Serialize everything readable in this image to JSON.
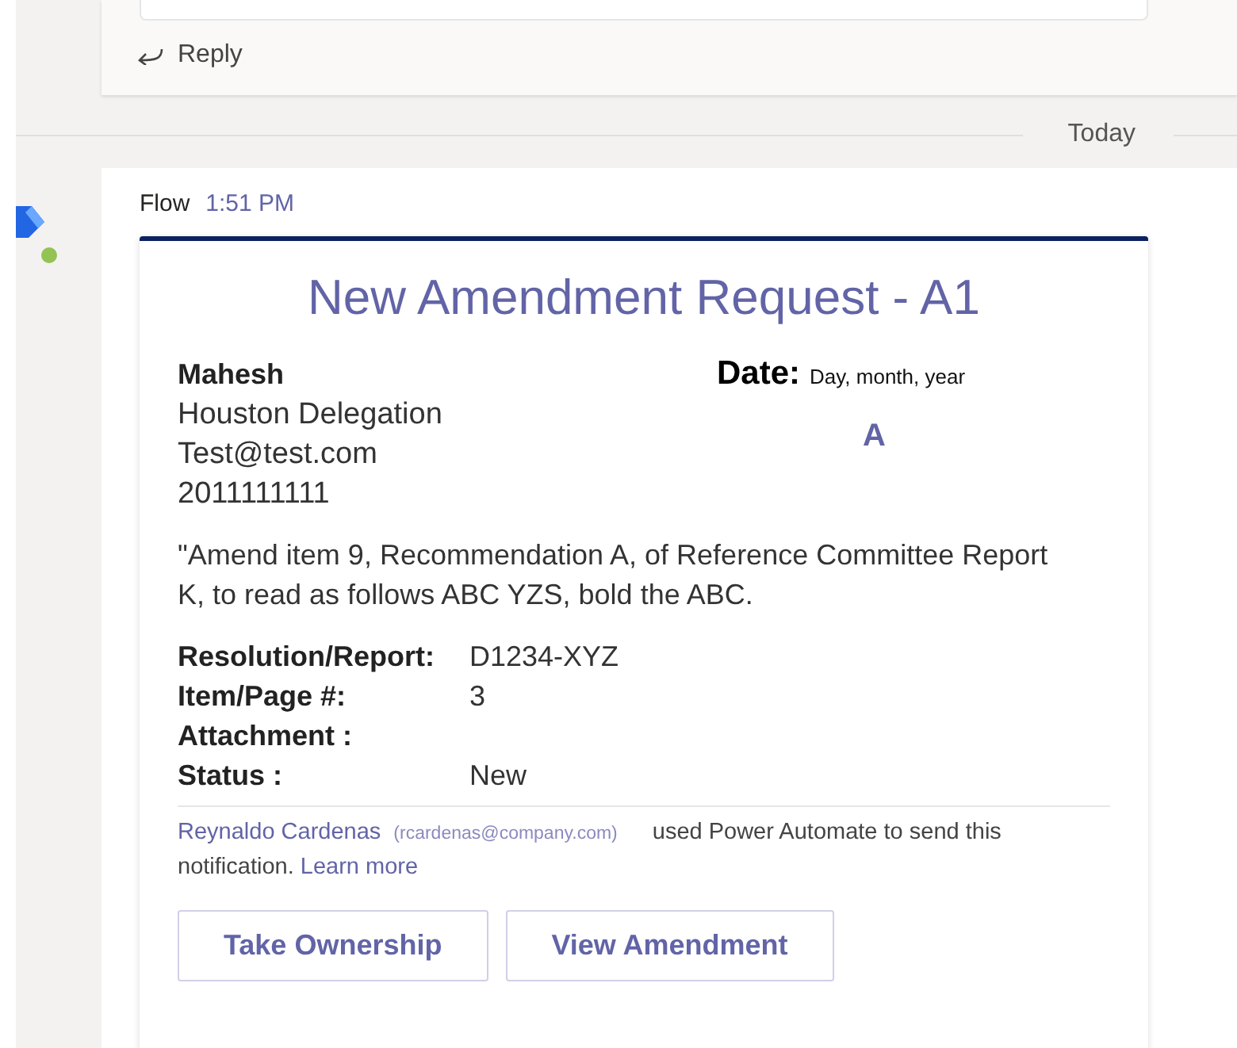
{
  "previous_message": {
    "reply_label": "Reply"
  },
  "date_divider": "Today",
  "message": {
    "sender": "Flow",
    "time": "1:51 PM",
    "card": {
      "title": "New Amendment Request - A1",
      "requester": {
        "name": "Mahesh",
        "delegation": "Houston Delegation",
        "email": "Test@test.com",
        "phone": "2011111111"
      },
      "date_label": "Date:",
      "date_value": "Day, month, year",
      "date_letter": "A",
      "description": "\"Amend item 9, Recommendation A, of Reference Committee Report K, to read as follows ABC YZS, bold the ABC.",
      "facts": [
        {
          "label": "Resolution/Report:",
          "value": "D1234-XYZ"
        },
        {
          "label": "Item/Page #:",
          "value": "3"
        },
        {
          "label": "Attachment :"
        },
        {
          "label": "Status :",
          "value": "New"
        }
      ],
      "footer": {
        "user": "Reynaldo Cardenas",
        "email": "(rcardenas@company.com)",
        "text_before": "used Power Automate to send this",
        "text_after": "notification.",
        "link": "Learn more"
      },
      "actions": [
        "Take Ownership",
        "View Amendment"
      ]
    }
  }
}
